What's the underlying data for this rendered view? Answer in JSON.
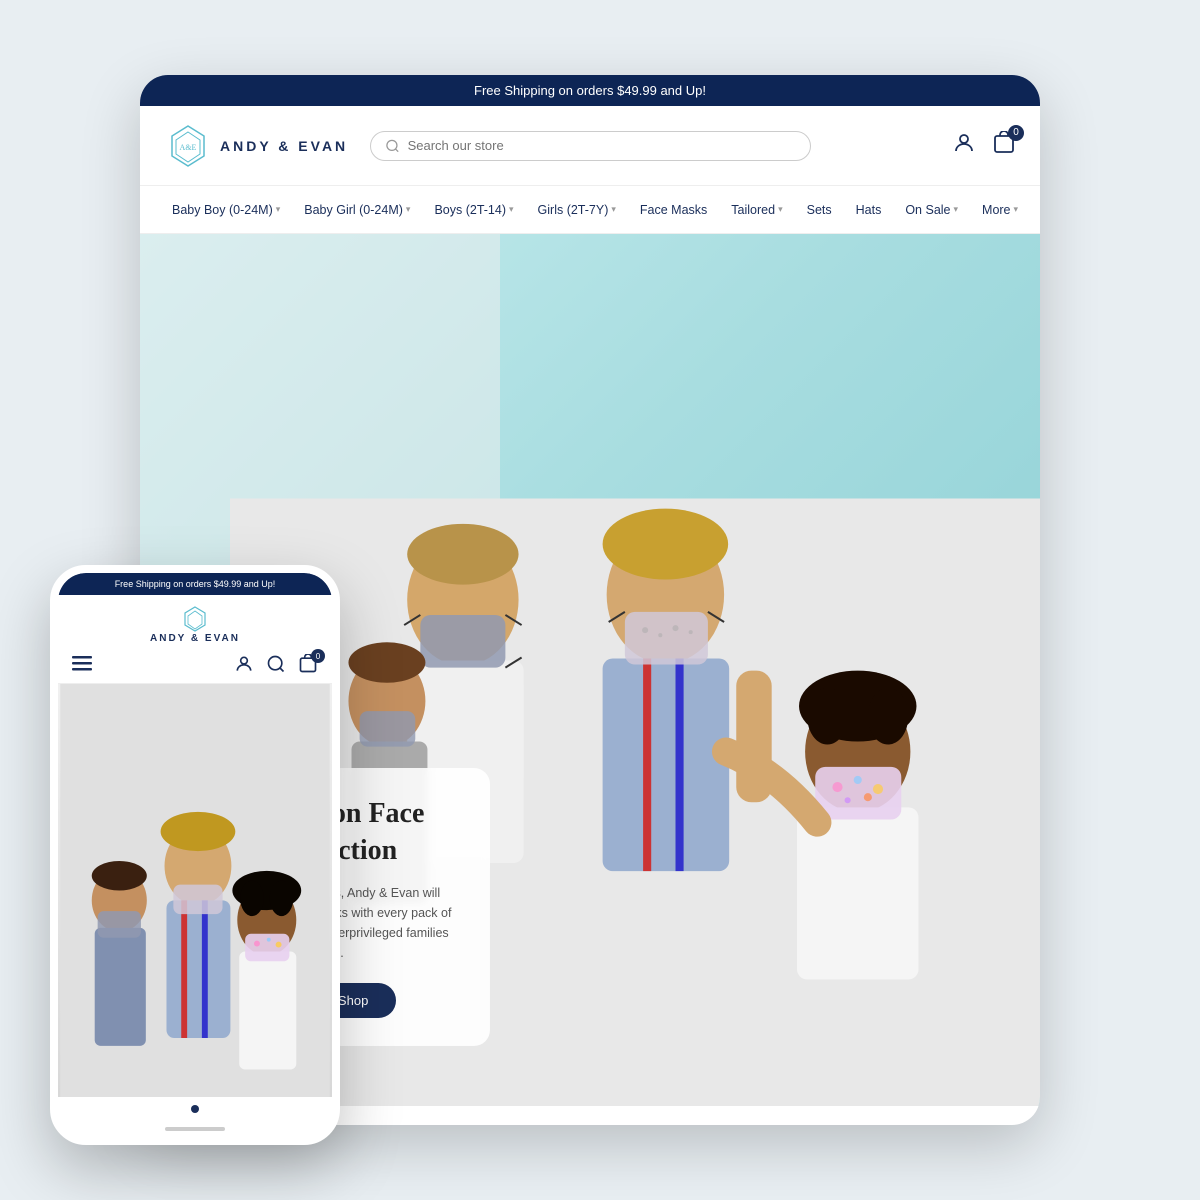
{
  "colors": {
    "navy": "#0d2255",
    "teal": "#5abcce",
    "white": "#ffffff",
    "lightBlue": "#b8e8ea",
    "bg": "#e8eef2"
  },
  "announcement": {
    "text": "Free Shipping on orders $49.99 and Up!"
  },
  "header": {
    "logo_text": "ANDY & EVAN",
    "search_placeholder": "Search our store",
    "cart_count": "0"
  },
  "nav": {
    "items": [
      {
        "label": "Baby Boy (0-24M)",
        "has_dropdown": true
      },
      {
        "label": "Baby Girl (0-24M)",
        "has_dropdown": true
      },
      {
        "label": "Boys (2T-14)",
        "has_dropdown": true
      },
      {
        "label": "Girls (2T-7Y)",
        "has_dropdown": true
      },
      {
        "label": "Face Masks",
        "has_dropdown": false
      },
      {
        "label": "Tailored",
        "has_dropdown": true
      },
      {
        "label": "Sets",
        "has_dropdown": false
      },
      {
        "label": "Hats",
        "has_dropdown": false
      },
      {
        "label": "On Sale",
        "has_dropdown": true
      },
      {
        "label": "More",
        "has_dropdown": true
      }
    ]
  },
  "hero": {
    "title": "100% Cotton Face Mask Collection",
    "description": "In an effort to help others, Andy & Evan will donate one pack of masks with every pack of masks purchased to underprivileged families in vulnerable populations.",
    "cta_label": "Click to Shop"
  },
  "phone": {
    "announcement": "Free Shipping on orders $49.99 and Up!",
    "logo_text": "ANDY & EVAN",
    "cart_count": "0"
  }
}
